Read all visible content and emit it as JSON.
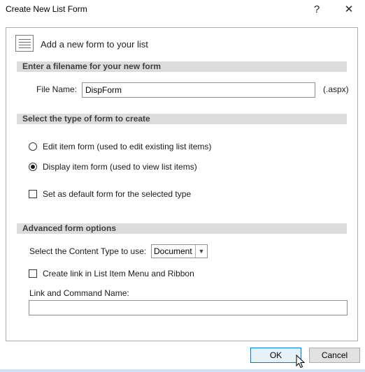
{
  "window": {
    "title": "Create New List Form",
    "help_glyph": "?",
    "close_glyph": "✕"
  },
  "header": {
    "icon": "list-form-icon",
    "text": "Add a new form to your list"
  },
  "filename_section": {
    "heading": "Enter a filename for your new form",
    "label": "File Name:",
    "value": "DispForm",
    "suffix": "(.aspx)"
  },
  "type_section": {
    "heading": "Select the type of form to create",
    "options": [
      {
        "label": "Edit item form (used to edit existing list items)",
        "selected": false
      },
      {
        "label": "Display item form (used to view list items)",
        "selected": true
      }
    ],
    "default_checkbox": {
      "label": "Set as default form for the selected type",
      "checked": false
    }
  },
  "advanced_section": {
    "heading": "Advanced form options",
    "content_type_label": "Select the Content Type to use:",
    "content_type_value": "Document",
    "menu_link_checkbox": {
      "label": "Create link in List Item Menu and Ribbon",
      "checked": false
    },
    "link_name_label": "Link and Command Name:",
    "link_name_value": ""
  },
  "buttons": {
    "ok": "OK",
    "cancel": "Cancel"
  },
  "colors": {
    "section_bar": "#dcdcdc",
    "default_button_border": "#0078d7",
    "default_button_bg": "#e5f1fb"
  }
}
